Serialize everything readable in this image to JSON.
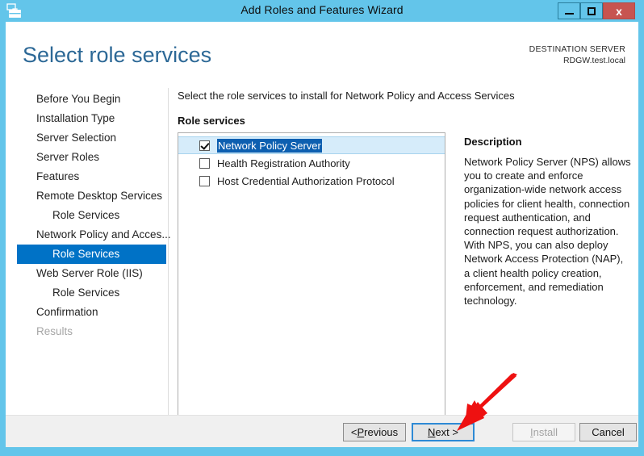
{
  "window": {
    "title": "Add Roles and Features Wizard",
    "icon": "wizard-server-icon",
    "controls": {
      "minimize": "–",
      "maximize": "□",
      "close": "x"
    },
    "accent_color": "#63c5ea",
    "close_color": "#c75450"
  },
  "header": {
    "page_title": "Select role services",
    "destination_label": "DESTINATION SERVER",
    "destination_server": "RDGW.test.local",
    "title_color": "#2c6896"
  },
  "sidebar": {
    "items": [
      {
        "label": "Before You Begin",
        "level": 0,
        "state": "normal"
      },
      {
        "label": "Installation Type",
        "level": 0,
        "state": "normal"
      },
      {
        "label": "Server Selection",
        "level": 0,
        "state": "normal"
      },
      {
        "label": "Server Roles",
        "level": 0,
        "state": "normal"
      },
      {
        "label": "Features",
        "level": 0,
        "state": "normal"
      },
      {
        "label": "Remote Desktop Services",
        "level": 0,
        "state": "normal"
      },
      {
        "label": "Role Services",
        "level": 1,
        "state": "normal"
      },
      {
        "label": "Network Policy and Acces...",
        "level": 0,
        "state": "normal"
      },
      {
        "label": "Role Services",
        "level": 1,
        "state": "selected"
      },
      {
        "label": "Web Server Role (IIS)",
        "level": 0,
        "state": "normal"
      },
      {
        "label": "Role Services",
        "level": 1,
        "state": "normal"
      },
      {
        "label": "Confirmation",
        "level": 0,
        "state": "normal"
      },
      {
        "label": "Results",
        "level": 0,
        "state": "disabled"
      }
    ],
    "selected_color": "#0072c6"
  },
  "main": {
    "instruction": "Select the role services to install for Network Policy and Access Services",
    "role_services_label": "Role services",
    "role_services": [
      {
        "label": "Network Policy Server",
        "checked": true,
        "selected": true
      },
      {
        "label": "Health Registration Authority",
        "checked": false,
        "selected": false
      },
      {
        "label": "Host Credential Authorization Protocol",
        "checked": false,
        "selected": false
      }
    ],
    "selection_highlight_color": "#0d5fb0",
    "selection_row_color": "#d6ecfa"
  },
  "description": {
    "title": "Description",
    "body": "Network Policy Server (NPS) allows you to create and enforce organization-wide network access policies for client health, connection request authentication, and connection request authorization. With NPS, you can also deploy Network Access Protection (NAP), a client health policy creation, enforcement, and remediation technology."
  },
  "footer": {
    "previous": "< Previous",
    "previous_accel_prefix": "< ",
    "previous_accel": "P",
    "previous_rest": "revious",
    "next_accel": "N",
    "next_rest": "ext >",
    "install_accel": "I",
    "install_rest": "nstall",
    "cancel": "Cancel",
    "next_focused": true,
    "install_enabled": false
  },
  "annotation": {
    "arrow_color": "#ee1111",
    "arrow_points_to": "next-button"
  }
}
